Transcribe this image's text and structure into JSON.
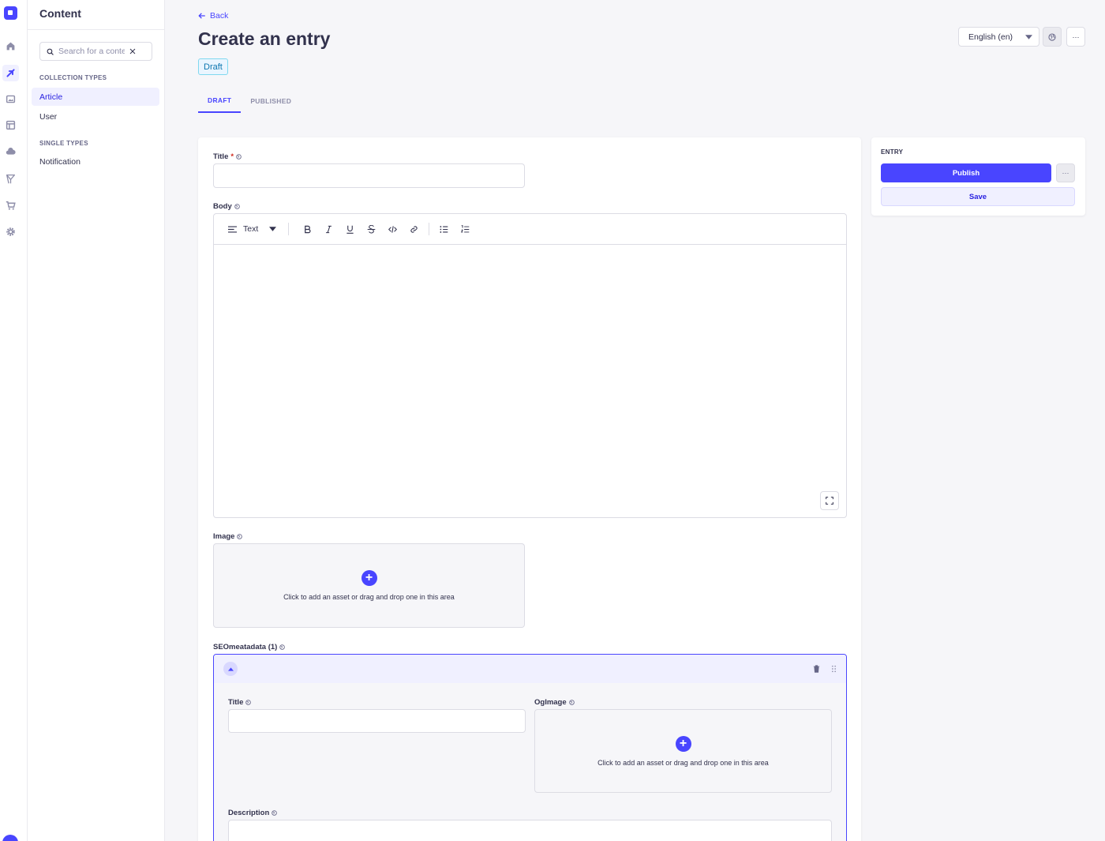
{
  "subnav": {
    "title": "Content",
    "search_placeholder": "Search for a content type",
    "collection_label": "COLLECTION TYPES",
    "collection_items": [
      "Article",
      "User"
    ],
    "single_label": "SINGLE TYPES",
    "single_items": [
      "Notification"
    ]
  },
  "header": {
    "back_label": "Back",
    "title": "Create an entry",
    "status_badge": "Draft",
    "locale": "English (en)",
    "more": "···"
  },
  "tabs": [
    "DRAFT",
    "PUBLISHED"
  ],
  "form": {
    "title_label": "Title",
    "title_required": "*",
    "body_label": "Body",
    "editor_block_type": "Text",
    "image_label": "Image",
    "dropzone_text": "Click to add an asset or drag and drop one in this area",
    "component_label": "SEOmeatadata (1)",
    "comp_title_label": "Title",
    "comp_ogimage_label": "OgImage",
    "comp_description_label": "Description"
  },
  "entry": {
    "label": "ENTRY",
    "publish": "Publish",
    "save": "Save",
    "more": "···"
  },
  "colors": {
    "primary": "#4945ff",
    "primary_light": "#f0f0ff",
    "text": "#32324d",
    "neutral": "#dcdce4"
  }
}
